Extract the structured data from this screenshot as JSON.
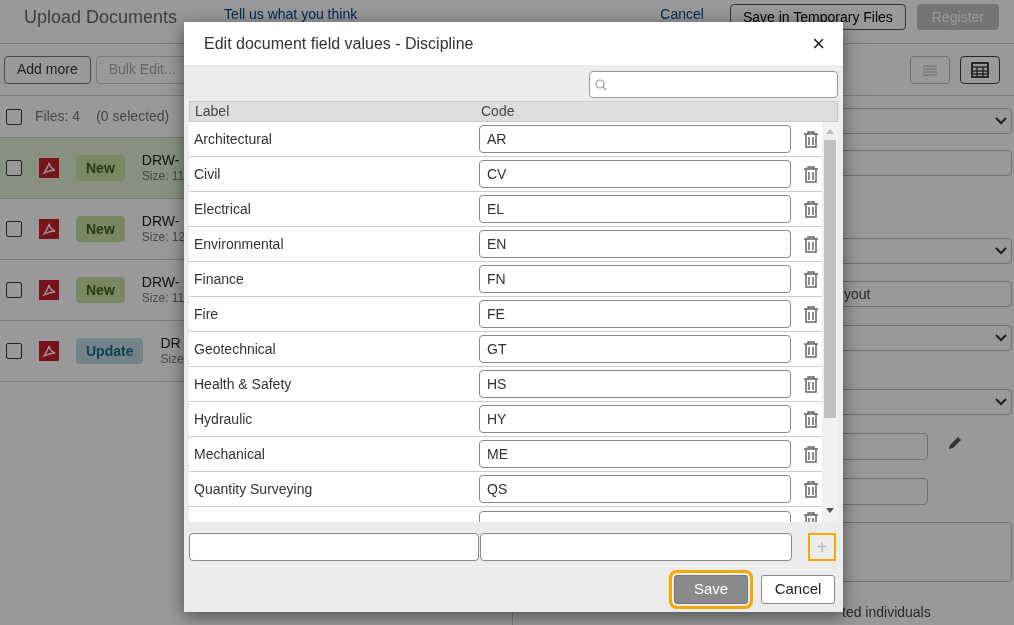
{
  "page": {
    "title": "Upload Documents",
    "feedback_link": "Tell us what you think",
    "cancel_link": "Cancel",
    "buttons": [
      {
        "label": "Save in Temporary Files",
        "kind": "secondary"
      },
      {
        "label": "Register",
        "kind": "primary",
        "disabled": true
      }
    ]
  },
  "toolbar": {
    "buttons": [
      {
        "label": "Add more",
        "disabled": false
      },
      {
        "label": "Bulk Edit...",
        "disabled": true
      }
    ],
    "view_buttons": [
      {
        "kind": "list",
        "selected": false
      },
      {
        "kind": "table",
        "selected": true
      }
    ]
  },
  "files": {
    "count": "Files: 4",
    "selected_count": "(0 selected)",
    "checked": false,
    "rows": [
      {
        "status": "New",
        "kind": "new",
        "name": "DRW-",
        "size": "Size: 11",
        "checked": false,
        "highlighted": true
      },
      {
        "status": "New",
        "kind": "new",
        "name": "DRW-",
        "size": "Size: 12",
        "checked": false,
        "highlighted": false
      },
      {
        "status": "New",
        "kind": "new",
        "name": "DRW-",
        "size": "Size: 11",
        "checked": false,
        "highlighted": false
      },
      {
        "status": "Update",
        "kind": "update",
        "name": "DR",
        "size": "Size",
        "checked": false,
        "highlighted": false
      }
    ]
  },
  "form": {
    "fields": [
      {
        "kind": "select"
      },
      {
        "kind": "text"
      },
      {
        "kind": "select"
      },
      {
        "kind": "text",
        "value": "yout"
      },
      {
        "kind": "select"
      },
      {
        "kind": "select"
      },
      {
        "kind": "short",
        "editable": true
      },
      {
        "kind": "short"
      },
      {
        "kind": "textarea"
      }
    ],
    "checkbox_label": "ted individuals"
  },
  "dialog": {
    "title": "Edit document field values - Discipline",
    "close": "×",
    "columns": [
      "Label",
      "Code"
    ],
    "rows": [
      {
        "label": "Architectural",
        "code": "AR"
      },
      {
        "label": "Civil",
        "code": "CV"
      },
      {
        "label": "Electrical",
        "code": "EL"
      },
      {
        "label": "Environmental",
        "code": "EN"
      },
      {
        "label": "Finance",
        "code": "FN"
      },
      {
        "label": "Fire",
        "code": "FE"
      },
      {
        "label": "Geotechnical",
        "code": "GT"
      },
      {
        "label": "Health & Safety",
        "code": "HS"
      },
      {
        "label": "Hydraulic",
        "code": "HY"
      },
      {
        "label": "Mechanical",
        "code": "ME"
      },
      {
        "label": "Quantity Surveying",
        "code": "QS"
      }
    ],
    "add_button": {
      "label": "+",
      "highlighted": true
    },
    "buttons": [
      {
        "label": "Save",
        "kind": "primary",
        "highlighted": true
      },
      {
        "label": "Cancel",
        "kind": "secondary",
        "highlighted": false
      }
    ]
  }
}
